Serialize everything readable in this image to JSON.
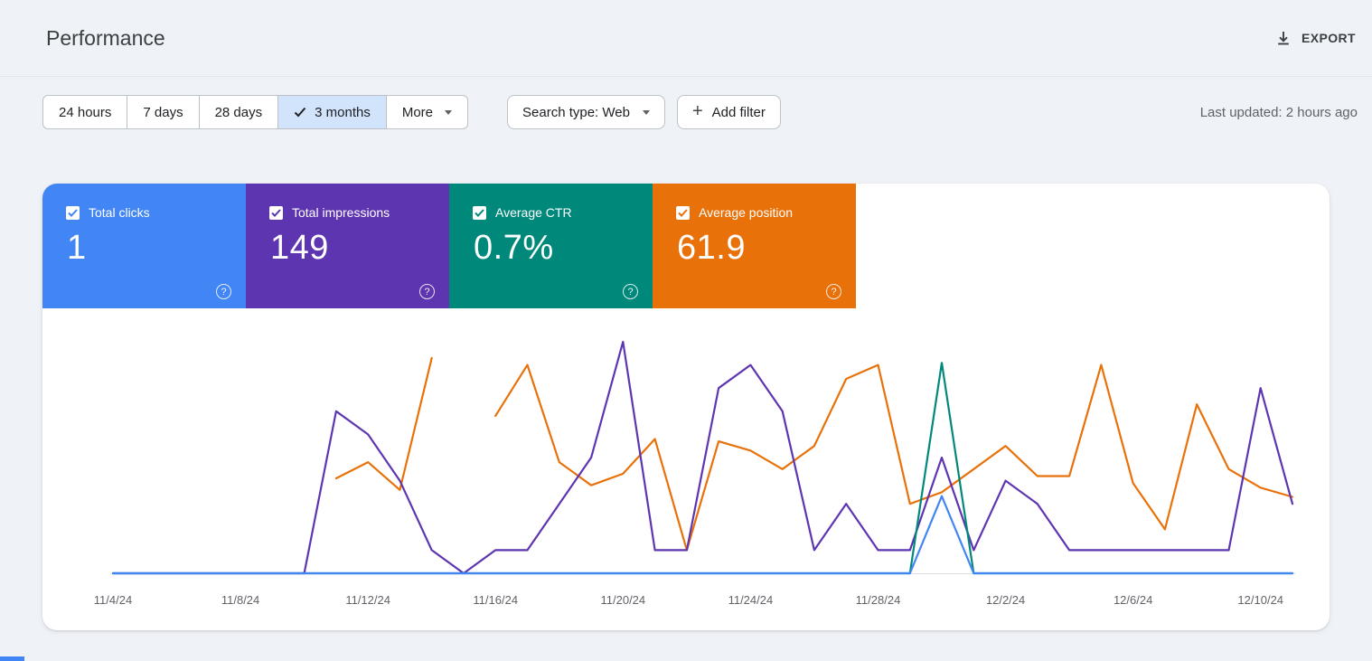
{
  "header": {
    "title": "Performance",
    "export_label": "EXPORT"
  },
  "toolbar": {
    "date_ranges": [
      {
        "label": "24 hours",
        "selected": false
      },
      {
        "label": "7 days",
        "selected": false
      },
      {
        "label": "28 days",
        "selected": false
      },
      {
        "label": "3 months",
        "selected": true
      },
      {
        "label": "More",
        "selected": false,
        "has_dropdown": true
      }
    ],
    "search_type": "Search type: Web",
    "add_filter_label": "Add filter",
    "last_updated": "Last updated: 2 hours ago"
  },
  "cards": [
    {
      "label": "Total clicks",
      "value": "1",
      "color": "#4285f4",
      "checked": true
    },
    {
      "label": "Total impressions",
      "value": "149",
      "color": "#5e35b1",
      "checked": true
    },
    {
      "label": "Average CTR",
      "value": "0.7%",
      "color": "#00897b",
      "checked": true
    },
    {
      "label": "Average position",
      "value": "61.9",
      "color": "#e8710a",
      "checked": true
    }
  ],
  "chart_data": {
    "type": "line",
    "title": "",
    "xlabel": "",
    "ylabel": "",
    "start_date": "11/4/24",
    "end_date": "12/11/24",
    "num_days": 38,
    "x_label_interval_days": 4,
    "x_labels": [
      "11/4/24",
      "11/8/24",
      "11/12/24",
      "11/16/24",
      "11/20/24",
      "11/24/24",
      "11/28/24",
      "12/2/24",
      "12/6/24",
      "12/10/24"
    ],
    "grid": false,
    "legend_position": "none",
    "series": [
      {
        "id": "average-position",
        "name": "Average position",
        "color": "#e8710a",
        "axis_max": 100,
        "inverted": true,
        "values": [
          null,
          null,
          null,
          null,
          null,
          null,
          null,
          59,
          52,
          64,
          7,
          null,
          32,
          10,
          52,
          62,
          57,
          42,
          90,
          43,
          47,
          55,
          45,
          16,
          10,
          70,
          65,
          55,
          45,
          58,
          58,
          10,
          61,
          81,
          27,
          55,
          63,
          67
        ]
      },
      {
        "id": "total-impressions",
        "name": "Total impressions",
        "color": "#5e35b1",
        "axis_max": 10,
        "inverted": false,
        "values": [
          0,
          0,
          0,
          0,
          0,
          0,
          0,
          7,
          6,
          4,
          1,
          0,
          1,
          1,
          3,
          5,
          10,
          1,
          1,
          8,
          9,
          7,
          1,
          3,
          1,
          1,
          5,
          1,
          4,
          3,
          1,
          1,
          1,
          1,
          1,
          1,
          8,
          3
        ]
      },
      {
        "id": "average-ctr",
        "name": "Average CTR (%)",
        "color": "#00897b",
        "axis_max": 55,
        "inverted": false,
        "values": [
          0,
          0,
          0,
          0,
          0,
          0,
          0,
          0,
          0,
          0,
          0,
          0,
          0,
          0,
          0,
          0,
          0,
          0,
          0,
          0,
          0,
          0,
          0,
          0,
          0,
          0,
          50,
          0,
          0,
          0,
          0,
          0,
          0,
          0,
          0,
          0,
          0,
          0
        ]
      },
      {
        "id": "total-clicks",
        "name": "Total clicks",
        "color": "#4285f4",
        "axis_max": 3,
        "inverted": false,
        "values": [
          0,
          0,
          0,
          0,
          0,
          0,
          0,
          0,
          0,
          0,
          0,
          0,
          0,
          0,
          0,
          0,
          0,
          0,
          0,
          0,
          0,
          0,
          0,
          0,
          0,
          0,
          1,
          0,
          0,
          0,
          0,
          0,
          0,
          0,
          0,
          0,
          0,
          0
        ]
      }
    ]
  }
}
